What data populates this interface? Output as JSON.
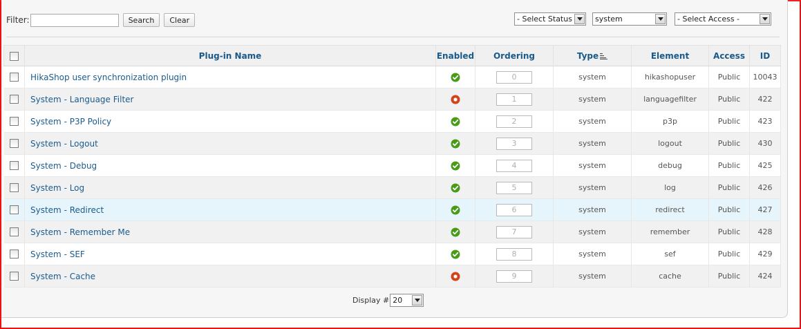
{
  "filter": {
    "label": "Filter:",
    "value": "",
    "search_label": "Search",
    "clear_label": "Clear"
  },
  "selects": {
    "status": "- Select Status -",
    "type": "system",
    "access": "- Select Access -"
  },
  "table": {
    "headers": {
      "name": "Plug-in Name",
      "enabled": "Enabled",
      "ordering": "Ordering",
      "type": "Type",
      "element": "Element",
      "access": "Access",
      "id": "ID"
    },
    "rows": [
      {
        "name": "HikaShop user synchronization plugin",
        "enabled": true,
        "ordering": "0",
        "type": "system",
        "element": "hikashopuser",
        "access": "Public",
        "id": "10043"
      },
      {
        "name": "System - Language Filter",
        "enabled": false,
        "ordering": "1",
        "type": "system",
        "element": "languagefilter",
        "access": "Public",
        "id": "422"
      },
      {
        "name": "System - P3P Policy",
        "enabled": true,
        "ordering": "2",
        "type": "system",
        "element": "p3p",
        "access": "Public",
        "id": "423"
      },
      {
        "name": "System - Logout",
        "enabled": true,
        "ordering": "3",
        "type": "system",
        "element": "logout",
        "access": "Public",
        "id": "430"
      },
      {
        "name": "System - Debug",
        "enabled": true,
        "ordering": "4",
        "type": "system",
        "element": "debug",
        "access": "Public",
        "id": "425"
      },
      {
        "name": "System - Log",
        "enabled": true,
        "ordering": "5",
        "type": "system",
        "element": "log",
        "access": "Public",
        "id": "426"
      },
      {
        "name": "System - Redirect",
        "enabled": true,
        "ordering": "6",
        "type": "system",
        "element": "redirect",
        "access": "Public",
        "id": "427"
      },
      {
        "name": "System - Remember Me",
        "enabled": true,
        "ordering": "7",
        "type": "system",
        "element": "remember",
        "access": "Public",
        "id": "428"
      },
      {
        "name": "System - SEF",
        "enabled": true,
        "ordering": "8",
        "type": "system",
        "element": "sef",
        "access": "Public",
        "id": "429"
      },
      {
        "name": "System - Cache",
        "enabled": false,
        "ordering": "9",
        "type": "system",
        "element": "cache",
        "access": "Public",
        "id": "424"
      }
    ]
  },
  "footer": {
    "display_label": "Display #",
    "display_value": "20"
  },
  "colors": {
    "enabled": "#4a9a1a",
    "disabled": "#d2441a",
    "link": "#1b5b8e",
    "frame": "#ee1111"
  },
  "icons": {
    "enabled": "check-circle-icon",
    "disabled": "unpublished-circle-icon",
    "sort": "sort-ascending-icon"
  }
}
